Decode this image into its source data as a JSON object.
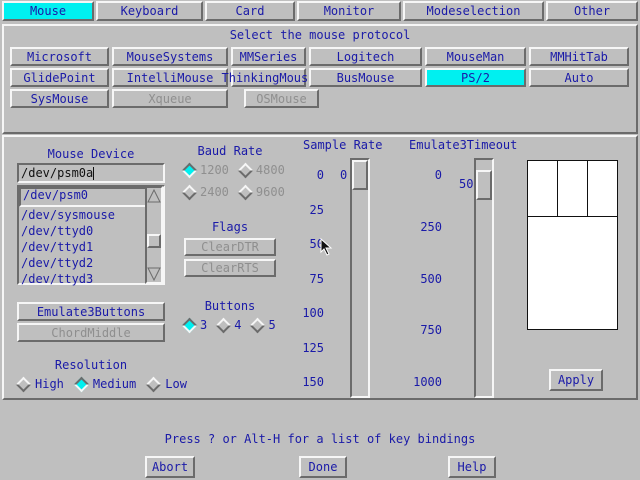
{
  "tabs": [
    {
      "label": "Mouse",
      "active": true
    },
    {
      "label": "Keyboard",
      "active": false
    },
    {
      "label": "Card",
      "active": false
    },
    {
      "label": "Monitor",
      "active": false
    },
    {
      "label": "Modeselection",
      "active": false
    },
    {
      "label": "Other",
      "active": false
    }
  ],
  "protocol": {
    "title": "Select the mouse protocol",
    "buttons": [
      {
        "label": "Microsoft",
        "state": "normal"
      },
      {
        "label": "MouseSystems",
        "state": "normal"
      },
      {
        "label": "MMSeries",
        "state": "normal"
      },
      {
        "label": "Logitech",
        "state": "normal"
      },
      {
        "label": "MouseMan",
        "state": "normal"
      },
      {
        "label": "MMHitTab",
        "state": "normal"
      },
      {
        "label": "GlidePoint",
        "state": "normal"
      },
      {
        "label": "IntelliMouse",
        "state": "normal"
      },
      {
        "label": "ThinkingMouse",
        "state": "normal"
      },
      {
        "label": "BusMouse",
        "state": "normal"
      },
      {
        "label": "PS/2",
        "state": "selected"
      },
      {
        "label": "Auto",
        "state": "normal"
      },
      {
        "label": "SysMouse",
        "state": "normal"
      },
      {
        "label": "Xqueue",
        "state": "disabled"
      },
      {
        "label": "OSMouse",
        "state": "disabled"
      }
    ]
  },
  "device": {
    "label": "Mouse Device",
    "value": "/dev/psm0a",
    "items": [
      "/dev/psm0",
      "/dev/sysmouse",
      "/dev/ttyd0",
      "/dev/ttyd1",
      "/dev/ttyd2",
      "/dev/ttyd3"
    ],
    "emulate_label": "Emulate3Buttons",
    "chord_label": "ChordMiddle"
  },
  "baud": {
    "label": "Baud Rate",
    "options": [
      {
        "label": "1200",
        "checked": true
      },
      {
        "label": "4800",
        "checked": false
      },
      {
        "label": "2400",
        "checked": false
      },
      {
        "label": "9600",
        "checked": false
      }
    ]
  },
  "flags": {
    "label": "Flags",
    "clear_dtr": "ClearDTR",
    "clear_rts": "ClearRTS"
  },
  "buttons_group": {
    "label": "Buttons",
    "options": [
      {
        "label": "3",
        "checked": true
      },
      {
        "label": "4",
        "checked": false
      },
      {
        "label": "5",
        "checked": false
      }
    ]
  },
  "resolution": {
    "label": "Resolution",
    "options": [
      {
        "label": "High",
        "checked": false
      },
      {
        "label": "Medium",
        "checked": true
      },
      {
        "label": "Low",
        "checked": false
      }
    ]
  },
  "sample_rate": {
    "label": "Sample Rate",
    "ticks": [
      "0",
      "25",
      "50",
      "75",
      "100",
      "125",
      "150"
    ],
    "value": "0"
  },
  "emulate_timeout": {
    "label": "Emulate3Timeout",
    "ticks": [
      "0",
      "250",
      "500",
      "750",
      "1000"
    ],
    "value": "50"
  },
  "apply_label": "Apply",
  "status": "Press ? or Alt-H for a list of key bindings",
  "footer": {
    "abort": "Abort",
    "done": "Done",
    "help": "Help"
  }
}
